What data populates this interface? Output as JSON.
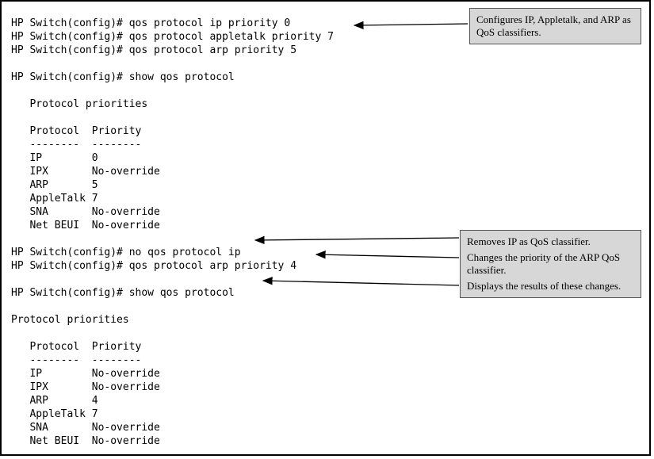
{
  "terminal": {
    "lines": [
      "HP Switch(config)# qos protocol ip priority 0",
      "HP Switch(config)# qos protocol appletalk priority 7",
      "HP Switch(config)# qos protocol arp priority 5",
      "",
      "HP Switch(config)# show qos protocol",
      "",
      "   Protocol priorities",
      "",
      "   Protocol  Priority",
      "   --------  --------",
      "   IP        0",
      "   IPX       No-override",
      "   ARP       5",
      "   AppleTalk 7",
      "   SNA       No-override",
      "   Net BEUI  No-override",
      "",
      "HP Switch(config)# no qos protocol ip",
      "HP Switch(config)# qos protocol arp priority 4",
      "",
      "HP Switch(config)# show qos protocol",
      "",
      "Protocol priorities",
      "",
      "   Protocol  Priority",
      "   --------  --------",
      "   IP        No-override",
      "   IPX       No-override",
      "   ARP       4",
      "   AppleTalk 7",
      "   SNA       No-override",
      "   Net BEUI  No-override"
    ]
  },
  "callouts": {
    "c1": "Configures IP, Appletalk, and ARP as QoS classifiers.",
    "c2_line1": "Removes IP as QoS classifier.",
    "c2_line2": "Changes the priority of the ARP QoS classifier.",
    "c2_line3": "Displays the results of these changes."
  }
}
